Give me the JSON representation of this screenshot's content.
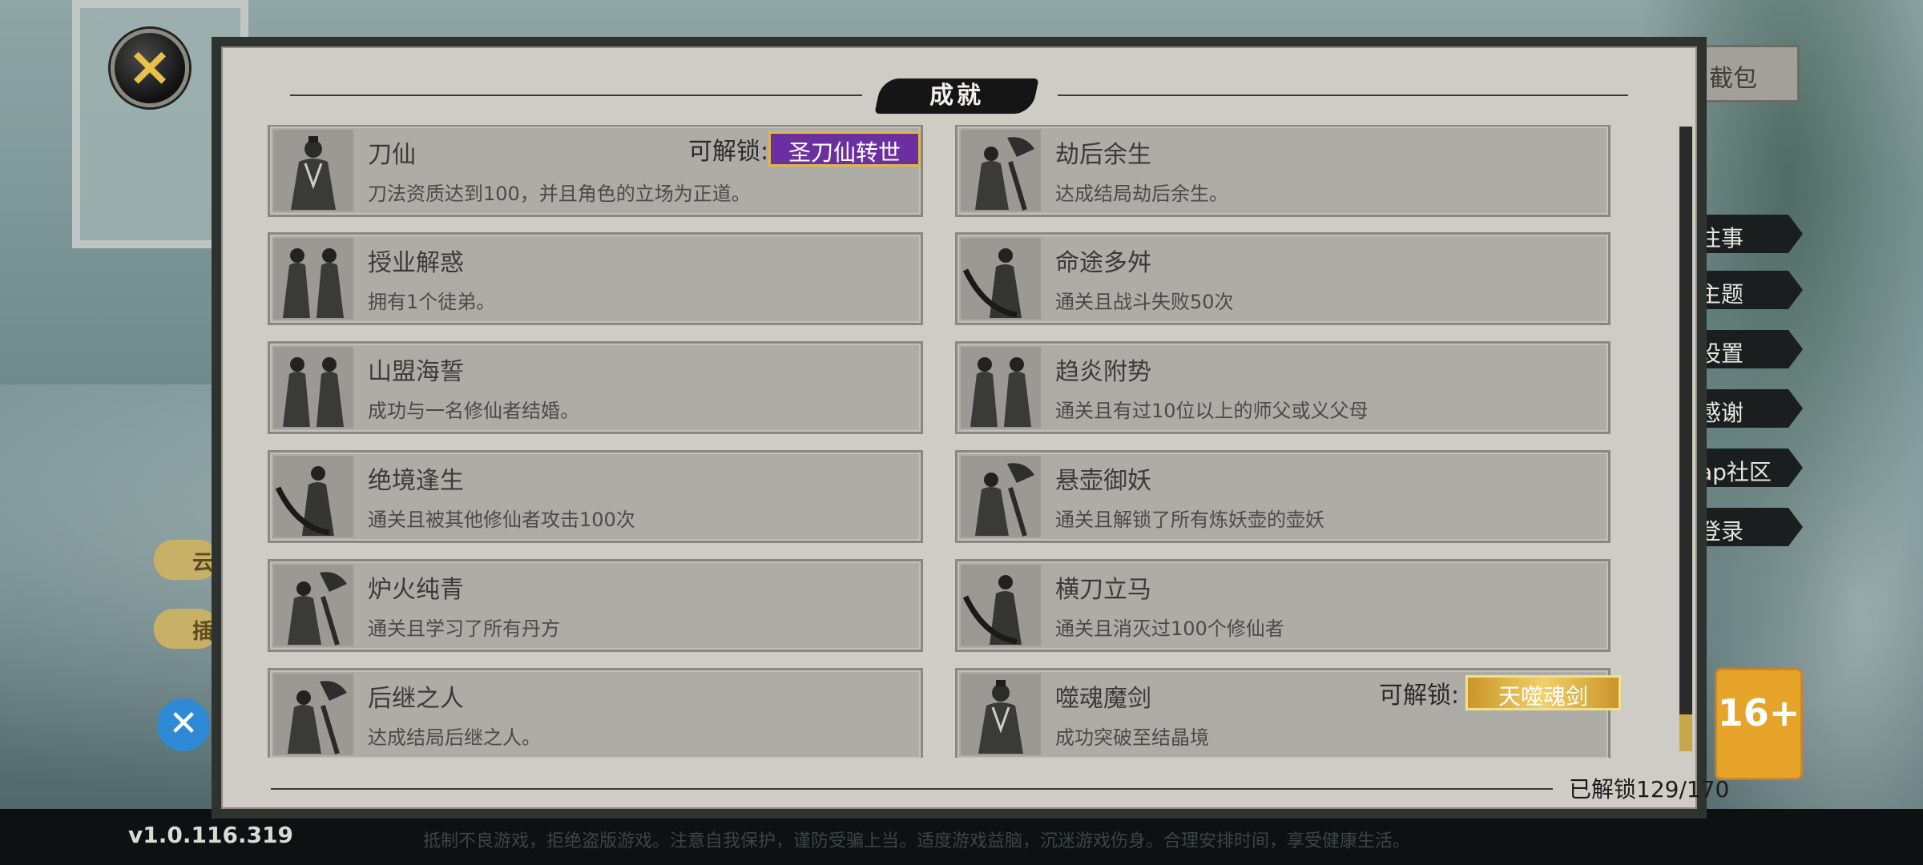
{
  "title": "成就",
  "version": "v1.0.116.319",
  "health_notice": "抵制不良游戏，拒绝盗版游戏。注意自我保护，谨防受骗上当。适度游戏益脑，沉迷游戏伤身。合理安排时间，享受健康生活。",
  "close_icon": "×",
  "side_menu": [
    "往事",
    "主题",
    "设置",
    "感谢",
    "ap社区",
    "登录"
  ],
  "top_right_tab": "截包",
  "left_pills": [
    "云",
    "插"
  ],
  "age_rating": "16+",
  "unlock_prefix": "可解锁:",
  "unlock_count": "已解锁129/170",
  "achievements": [
    {
      "title": "刀仙",
      "desc": "刀法资质达到100，并且角色的立场为正道。",
      "portrait": "robe",
      "unlock": "刀仙转世",
      "unlock_style": "purple",
      "unlock_icon": "圣"
    },
    {
      "title": "劫后余生",
      "desc": "达成结局劫后余生。",
      "portrait": "fan"
    },
    {
      "title": "授业解惑",
      "desc": "拥有1个徒弟。",
      "portrait": "pair"
    },
    {
      "title": "命途多舛",
      "desc": "通关且战斗失败50次",
      "portrait": "blade"
    },
    {
      "title": "山盟海誓",
      "desc": "成功与一名修仙者结婚。",
      "portrait": "pair"
    },
    {
      "title": "趋炎附势",
      "desc": "通关且有过10位以上的师父或义父母",
      "portrait": "pair"
    },
    {
      "title": "绝境逢生",
      "desc": "通关且被其他修仙者攻击100次",
      "portrait": "blade"
    },
    {
      "title": "悬壶御妖",
      "desc": "通关且解锁了所有炼妖壶的壶妖",
      "portrait": "fan"
    },
    {
      "title": "炉火纯青",
      "desc": "通关且学习了所有丹方",
      "portrait": "fan"
    },
    {
      "title": "横刀立马",
      "desc": "通关且消灭过100个修仙者",
      "portrait": "blade"
    },
    {
      "title": "后继之人",
      "desc": "达成结局后继之人。",
      "portrait": "fan"
    },
    {
      "title": "噬魂魔剑",
      "desc": "成功突破至结晶境",
      "portrait": "robe",
      "unlock": "噬魂剑",
      "unlock_style": "gold",
      "unlock_icon": "天"
    }
  ],
  "colors": {
    "purple_badge": "#6b2fa0",
    "gold_badge": "#e0b64a",
    "card_bg": "#aeaca7",
    "panel_bg": "#cfccc6"
  }
}
